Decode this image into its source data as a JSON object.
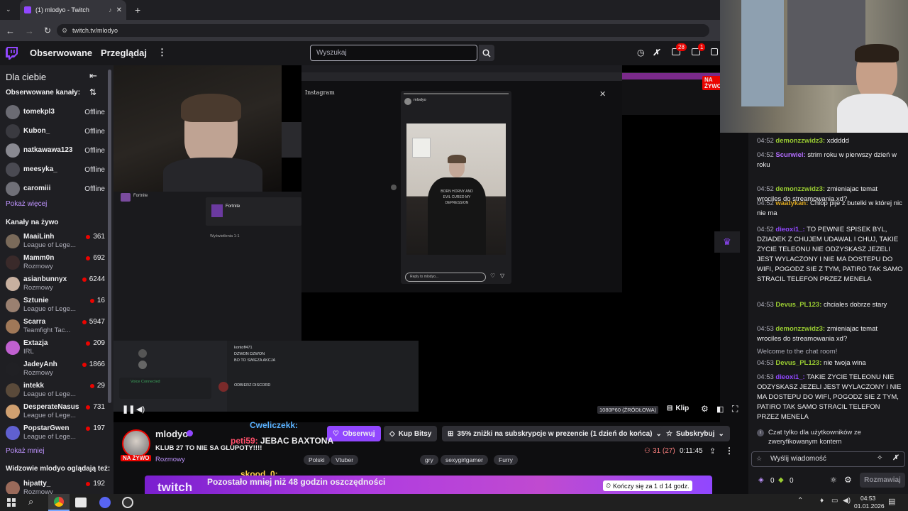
{
  "browser": {
    "tab_title": "(1) mlodyo - Twitch",
    "url": "twitch.tv/mlodyo"
  },
  "nav": {
    "followed": "Obserwowane",
    "browse": "Przeglądaj",
    "search_placeholder": "Wyszukaj",
    "notif_count": "28",
    "inbox_count": "1"
  },
  "sidebar": {
    "for_you": "Dla ciebie",
    "followed_header": "Obserwowane kanały:",
    "followed": [
      {
        "name": "tomekpl3",
        "status": "Offline"
      },
      {
        "name": "Kubon_",
        "status": "Offline"
      },
      {
        "name": "natkawawa123",
        "status": "Offline"
      },
      {
        "name": "meesyka_",
        "status": "Offline"
      },
      {
        "name": "caromiii",
        "status": "Offline"
      }
    ],
    "show_more": "Pokaż więcej",
    "live_header": "Kanały na żywo",
    "live": [
      {
        "name": "MaaiLinh",
        "game": "League of Lege...",
        "viewers": "361"
      },
      {
        "name": "Mamm0n",
        "game": "Rozmowy",
        "viewers": "692"
      },
      {
        "name": "asianbunnyx",
        "game": "Rozmowy",
        "viewers": "6244"
      },
      {
        "name": "Sztunie",
        "game": "League of Lege...",
        "viewers": "16"
      },
      {
        "name": "Scarra",
        "game": "Teamfight Tac...",
        "viewers": "5947"
      },
      {
        "name": "Extazja",
        "game": "IRL",
        "viewers": "209"
      },
      {
        "name": "JadeyAnh",
        "game": "Rozmowy",
        "viewers": "1866"
      },
      {
        "name": "intekk",
        "game": "League of Lege...",
        "viewers": "29"
      },
      {
        "name": "DesperateNasus",
        "game": "League of Lege...",
        "viewers": "731"
      },
      {
        "name": "PopstarGwen",
        "game": "League of Lege...",
        "viewers": "197"
      }
    ],
    "show_less": "Pokaż mniej",
    "also_watch": "Widzowie mlodyo oglądają też:",
    "also": [
      {
        "name": "hipatty_",
        "game": "Rozmowy",
        "viewers": "192"
      }
    ]
  },
  "player": {
    "quality": "1080P60 (ŹRÓDŁOWA)",
    "clip": "Klip",
    "live_badge": "NA ŻYWO",
    "instagram": {
      "logo": "Instagram",
      "user": "mlodyo",
      "reply_placeholder": "Reply to mlodyo...",
      "shirt_text": "BORN HORNY AND EVIL CURED MY DEPRESSION"
    },
    "desktop": {
      "game": "Fortnite",
      "views": "Wyświetlenia 1-1",
      "discord_lines": [
        "kontoff471",
        "DZWON DZWON",
        "BO TO SWIEZA AKCJA",
        "ODBIERZ DISCORD"
      ],
      "voice": "Voice Connected"
    }
  },
  "info": {
    "streamer": "mlodyo",
    "title": "KLUB 27 TO NIE SA GLUPOTY!!!!",
    "category": "Rozmowy",
    "live": "NA ŻYWO",
    "tags": [
      "Polski",
      "Vtuber",
      "gry",
      "sexygirlgamer",
      "Furry"
    ],
    "follow": "Obserwuj",
    "bits": "Kup Bitsy",
    "promo": "35% zniżki na subskrypcje w prezencie (1 dzień do końca)",
    "subscribe": "Subskrybuj",
    "viewers": "31 (27)",
    "uptime": "0:11:45",
    "overlay": [
      {
        "user": "Cweliczekk:",
        "text": ""
      },
      {
        "user": "peti59:",
        "text": "JEBAC BAXTONA"
      },
      {
        "user": "skood_0:",
        "text": ""
      }
    ],
    "banner_text": "Pozostało mniej niż 48 godzin oszczędności",
    "banner_logo": "twitch",
    "banner_timer": "Kończy się za 1 d 14 godz."
  },
  "chat": {
    "messages": [
      {
        "time": "04:52",
        "user": "demonzzwidz3:",
        "color": "#9acd32",
        "text": "xddddd"
      },
      {
        "time": "04:52",
        "user": "Scurwiel:",
        "color": "#b36dff",
        "text": "strim roku w pierwszy dzień w roku"
      },
      {
        "time": "04:52",
        "user": "demonzzwidz3:",
        "color": "#9acd32",
        "text": "zmieniajac temat wrociles do streamowania xd?"
      },
      {
        "time": "04:52",
        "user": "waatykan:",
        "color": "#daa520",
        "text": "Chlop pije z butelki w której nic nie ma"
      },
      {
        "time": "04:52",
        "user": "dieoxi1_:",
        "color": "#9147ff",
        "text": "TO PEWNIE SPISEK BYL, DZIADEK Z CHUJEM UDAWAL I CHUJ, TAKIE ZYCIE TELEONU NIE ODZYSKASZ JEZELI JEST WYLACZONY I NIE MA DOSTEPU DO WIFI, POGODZ SIE Z TYM, PATIRO TAK SAMO STRACIL TELEFON PRZEZ MENELA"
      },
      {
        "time": "04:53",
        "user": "Devus_PL123:",
        "color": "#9acd32",
        "text": "chciales dobrze stary"
      },
      {
        "time": "04:53",
        "user": "demonzzwidz3:",
        "color": "#9acd32",
        "text": "zmieniajac temat wrociles do streamowania xd?"
      },
      {
        "time": "",
        "user": "",
        "color": "#adadb8",
        "text": "Welcome to the chat room!"
      },
      {
        "time": "04:53",
        "user": "Devus_PL123:",
        "color": "#9acd32",
        "text": "nie twoja wina"
      },
      {
        "time": "04:53",
        "user": "dieoxi1_:",
        "color": "#9147ff",
        "text": "TAKIE ZYCIE TELEONU NIE ODZYSKASZ JEZELI JEST WYLACZONY I NIE MA DOSTEPU DO WIFI, POGODZ SIE Z TYM, PATIRO TAK SAMO STRACIL TELEFON PRZEZ MENELA"
      }
    ],
    "notice": "Czat tylko dla użytkowników ze zweryfikowanym kontem",
    "input_placeholder": "Wyślij wiadomość",
    "points": "0",
    "bits": "0",
    "chat_button": "Rozmawiaj"
  },
  "taskbar": {
    "time": "04:53",
    "date": "01.01.2026"
  },
  "colors": {
    "accent": "#9147ff",
    "live": "#eb0400"
  }
}
